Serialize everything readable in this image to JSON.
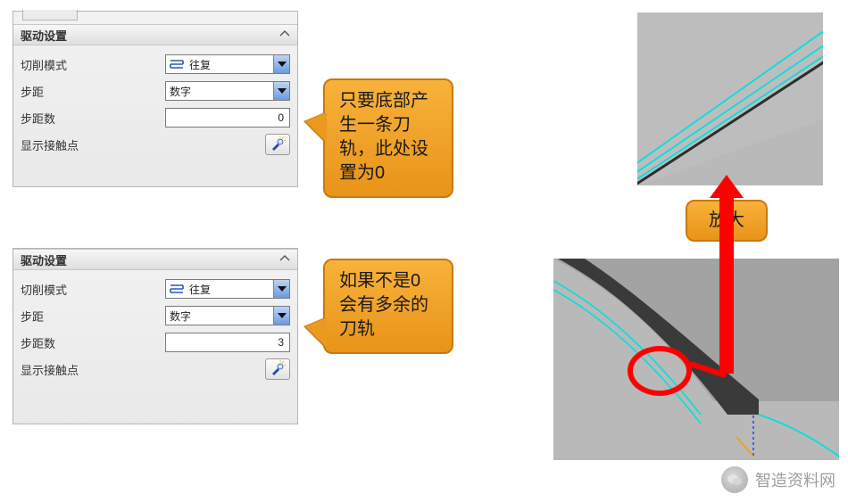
{
  "panel1": {
    "header": "驱动设置",
    "rows": {
      "mode_label": "切削模式",
      "mode_value": "往复",
      "step_label": "步距",
      "step_value": "数字",
      "stepcount_label": "步距数",
      "stepcount_value": "0",
      "showcontact_label": "显示接触点"
    }
  },
  "panel2": {
    "header": "驱动设置",
    "rows": {
      "mode_label": "切削模式",
      "mode_value": "往复",
      "step_label": "步距",
      "step_value": "数字",
      "stepcount_label": "步距数",
      "stepcount_value": "3",
      "showcontact_label": "显示接触点"
    }
  },
  "callouts": {
    "c1": "只要底部产生一条刀轨，此处设置为0",
    "c2": "如果不是0会有多余的刀轨",
    "zoom": "放大"
  },
  "watermark": {
    "text": "智造资料网"
  }
}
